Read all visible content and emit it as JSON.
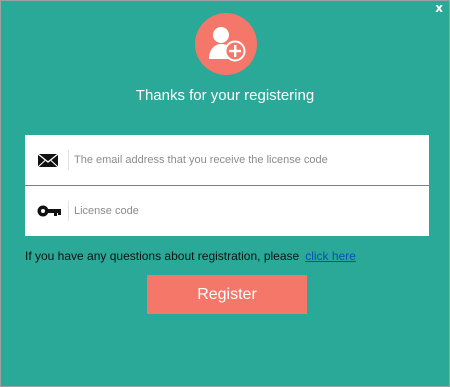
{
  "dialog": {
    "close_label": "x",
    "title": "Thanks for your registering",
    "avatar_icon": "add-user-icon",
    "colors": {
      "background": "#2aa898",
      "accent": "#f5776a",
      "link": "#0a4fb4"
    }
  },
  "form": {
    "email": {
      "icon": "envelope-icon",
      "placeholder": "The email address that you receive the license code",
      "value": ""
    },
    "license": {
      "icon": "key-icon",
      "placeholder": "License code",
      "value": ""
    }
  },
  "help": {
    "text": "If you have any questions about registration, please",
    "link_label": "click here"
  },
  "register_button": {
    "label": "Register"
  }
}
